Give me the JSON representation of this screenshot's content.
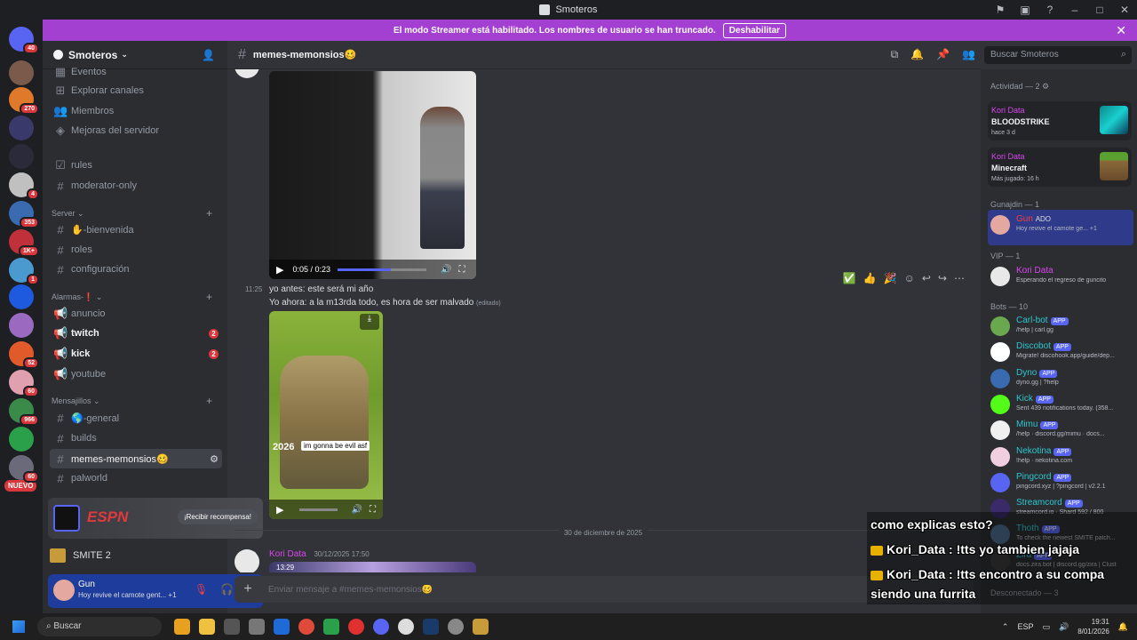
{
  "window": {
    "title": "Smoteros"
  },
  "banner": {
    "text": "El modo Streamer está habilitado. Los nombres de usuario se han truncado.",
    "button": "Deshabilitar"
  },
  "guilds": [
    {
      "color": "#5865f2",
      "badge": "40"
    },
    {
      "color": "#7a5a4a",
      "badge": ""
    },
    {
      "color": "#e07a2a",
      "badge": "270"
    },
    {
      "color": "#3a3a6a",
      "badge": ""
    },
    {
      "color": "#2a2a3a",
      "badge": ""
    },
    {
      "color": "#c0c0c0",
      "badge": "4"
    },
    {
      "color": "#3a6ab0",
      "badge": "353"
    },
    {
      "color": "#c0303a",
      "badge": "1K+"
    },
    {
      "color": "#4a9ad0",
      "badge": "1"
    },
    {
      "color": "#1e5adf",
      "badge": ""
    },
    {
      "color": "#9a6ac0",
      "badge": ""
    },
    {
      "color": "#e05a2a",
      "badge": "52"
    },
    {
      "color": "#e0a0b0",
      "badge": "60"
    },
    {
      "color": "#3a8a4a",
      "badge": "966"
    },
    {
      "color": "#2aa04a",
      "badge": ""
    },
    {
      "color": "#6a6a7a",
      "badge": "60"
    }
  ],
  "guild_nuevo": "NUEVO",
  "server": {
    "name": "Smoteros",
    "channels_top": [
      {
        "icon": "#",
        "name": "Eventos"
      },
      {
        "icon": "#",
        "name": "Explorar canales"
      },
      {
        "icon": "#",
        "name": "Miembros"
      },
      {
        "icon": "#",
        "name": "Mejoras del servidor"
      }
    ],
    "rules": "rules",
    "moderator": "moderator-only",
    "cat_server": "Server",
    "server_channels": [
      "✋-bienvenida",
      "roles",
      "configuración"
    ],
    "cat_alarmas": "Alarmas-❗",
    "alarm_channels": [
      {
        "name": "anuncio",
        "count": ""
      },
      {
        "name": "twitch",
        "count": "2"
      },
      {
        "name": "kick",
        "count": "2"
      },
      {
        "name": "youtube",
        "count": ""
      }
    ],
    "cat_mensajillos": "Mensajillos",
    "mens_channels": [
      "🌎-general",
      "builds",
      "memes-memonsios🥴",
      "palworld"
    ]
  },
  "promo": {
    "brand": "ESPN",
    "button": "¡Recibir recompensa!"
  },
  "game": {
    "name": "SMITE 2"
  },
  "user": {
    "name": "Gun",
    "status": "Hoy revive el camote gent...",
    "plus": "+1"
  },
  "channel": {
    "name": "memes-memonsios🥴"
  },
  "search_placeholder": "Buscar Smoteros",
  "video1": {
    "time": "0:05 / 0:23",
    "progress": 0.6
  },
  "message": {
    "time": "11:25",
    "line1": "yo antes: este será mi año",
    "line2": "Yo ahora: a la m13rda todo, es hora de ser malvado",
    "edited": "(editado)",
    "caption": "im gonna be evil asf",
    "year": "2026"
  },
  "date_separator": "30 de diciembre de 2025",
  "next_msg": {
    "author": "Kori Data",
    "time": "30/12/2025 17:50",
    "preview_time": "13:29"
  },
  "composer_placeholder": "Enviar mensaje a #memes-memonsios🥴",
  "members": {
    "activity_header": "Actividad — 2",
    "activities": [
      {
        "name": "Kori Data",
        "game": "BLOODSTRIKE",
        "time": "hace 3 d"
      },
      {
        "name": "Kori Data",
        "game": "Minecraft",
        "time": "Más jugado: 16 h"
      }
    ],
    "gunajdin_header": "Gunajdin — 1",
    "gunajdin": [
      {
        "name": "Gun",
        "tag": "ADO",
        "status": "Hoy revive el camote ge...",
        "plus": "+1"
      }
    ],
    "vip_header": "VIP — 1",
    "vip": [
      {
        "name": "Kori Data",
        "status": "Esperando el regreso de guncito"
      }
    ],
    "bots_header": "Bots — 10",
    "bots": [
      {
        "name": "Carl-bot",
        "status": "/help | carl.gg",
        "color": "#6aa84f"
      },
      {
        "name": "Discobot",
        "status": "Migrate! discohook.app/guide/dep...",
        "color": "#ffffff"
      },
      {
        "name": "Dyno",
        "status": "dyno.gg | ?help",
        "color": "#3a6ab0"
      },
      {
        "name": "Kick",
        "status": "Sent 439 notifications today. (358...",
        "color": "#53fc18"
      },
      {
        "name": "Mimu",
        "status": "/help · discord.gg/mimu · docs...",
        "color": "#f0f0f0"
      },
      {
        "name": "Nekotina",
        "status": "!help · nekotina.com",
        "color": "#f0d0e0"
      },
      {
        "name": "Pingcord",
        "status": "pingcord.xyz | ?pingcord | v2.2.1",
        "color": "#5865f2"
      },
      {
        "name": "Streamcord",
        "status": "streamcord.io · Shard 592 / 800",
        "color": "#3a2a6a"
      },
      {
        "name": "Thoth",
        "status": "To check the newest SMITE patch...",
        "color": "#4a6a8a"
      },
      {
        "name": "Zira",
        "status": "docs.zira.bot | discord.gg/zira | Clust",
        "color": "#3a3a3a"
      }
    ],
    "offline_header": "Desconectado — 3",
    "app_label": "APP"
  },
  "tts": [
    {
      "user": "",
      "text": "como explicas esto?"
    },
    {
      "user": "Kori_Data",
      "text": " : !tts yo tambien jajaja"
    },
    {
      "user": "Kori_Data",
      "text": " : !tts encontro a su compa"
    },
    {
      "user": "",
      "text": "siendo una furrita"
    }
  ],
  "taskbar": {
    "search": "Buscar",
    "lang": "ESP",
    "time": "19:31",
    "date": "8/01/2026"
  },
  "colors": {
    "accent": "#5865f2",
    "streamer_banner": "#a33fd1",
    "mention": "#da373c"
  }
}
